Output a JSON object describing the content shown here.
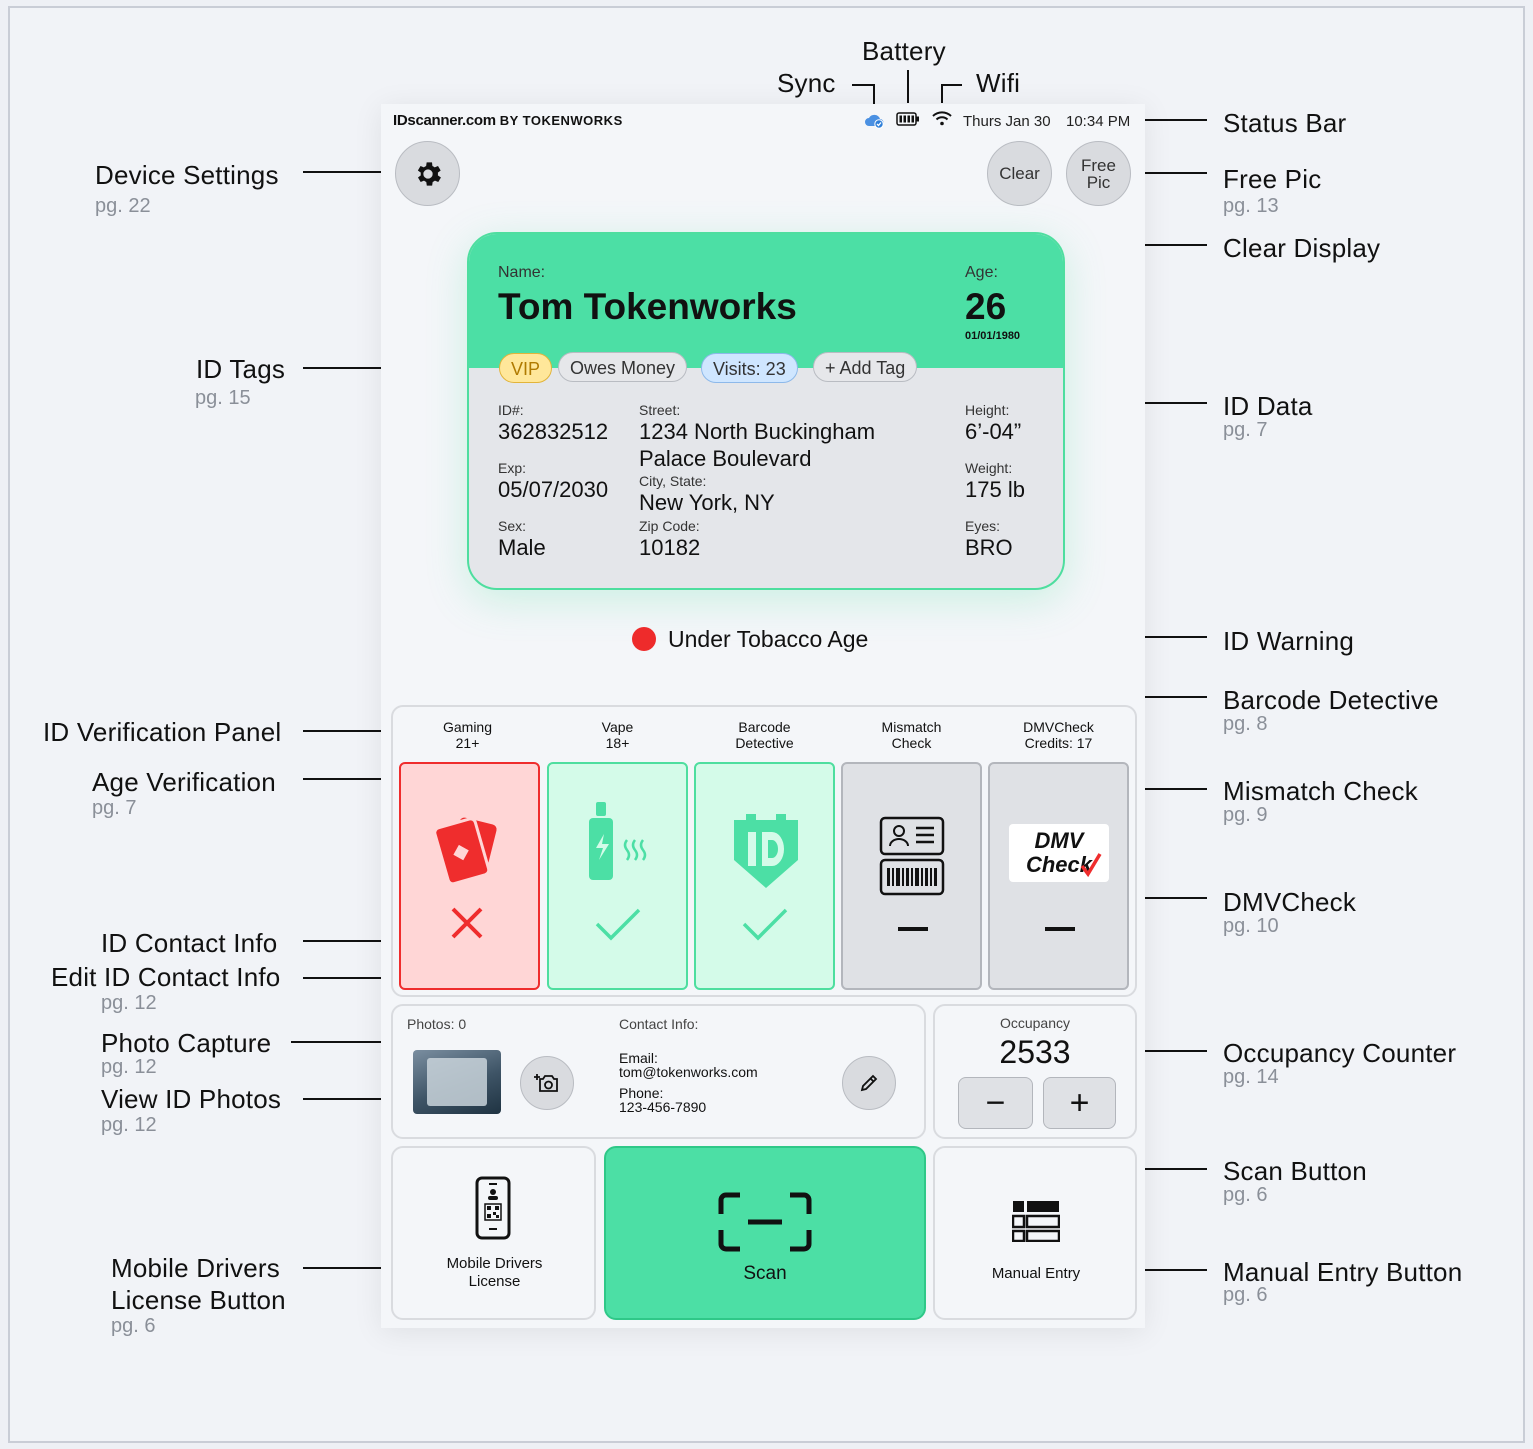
{
  "annotations": {
    "battery": "Battery",
    "sync": "Sync",
    "wifi": "Wifi",
    "status_bar": "Status Bar",
    "device_settings": "Device Settings",
    "device_settings_pg": "pg. 22",
    "free_pic": "Free Pic",
    "free_pic_pg": "pg. 13",
    "clear_display": "Clear Display",
    "id_tags": "ID Tags",
    "id_tags_pg": "pg. 15",
    "id_data": "ID Data",
    "id_data_pg": "pg. 7",
    "id_warning": "ID Warning",
    "barcode_detective": "Barcode Detective",
    "barcode_detective_pg": "pg. 8",
    "id_verification_panel": "ID Verification Panel",
    "age_verification": "Age Verification",
    "age_verification_pg": "pg. 7",
    "mismatch_check": "Mismatch Check",
    "mismatch_check_pg": "pg. 9",
    "dmvcheck": "DMVCheck",
    "dmvcheck_pg": "pg. 10",
    "id_contact_info": "ID Contact Info",
    "edit_id_contact_info": "Edit ID Contact Info",
    "edit_id_contact_info_pg": "pg. 12",
    "photo_capture": "Photo Capture",
    "photo_capture_pg": "pg. 12",
    "view_id_photos": "View ID Photos",
    "view_id_photos_pg": "pg. 12",
    "occupancy_counter": "Occupancy Counter",
    "occupancy_counter_pg": "pg. 14",
    "scan_button": "Scan Button",
    "scan_button_pg": "pg. 6",
    "mobile_dl_button_1": "Mobile Drivers",
    "mobile_dl_button_2": "License Button",
    "mobile_dl_button_pg": "pg. 6",
    "manual_entry_button": "Manual Entry Button",
    "manual_entry_button_pg": "pg. 6"
  },
  "device": {
    "brand": "IDscanner.com",
    "brand_by": "BY TOKENWORKS",
    "date": "Thurs Jan 30",
    "time": "10:34 PM",
    "clear_label": "Clear",
    "free_pic_line1": "Free",
    "free_pic_line2": "Pic"
  },
  "id_card": {
    "name_label": "Name:",
    "name": "Tom Tokenworks",
    "age_label": "Age:",
    "age": "26",
    "dob": "01/01/1980",
    "tags": [
      "VIP",
      "Owes Money",
      "Visits: 23",
      "+ Add Tag"
    ],
    "id_label": "ID#:",
    "id_value": "362832512",
    "exp_label": "Exp:",
    "exp_value": "05/07/2030",
    "sex_label": "Sex:",
    "sex_value": "Male",
    "street_label": "Street:",
    "street_line1": "1234 North Buckingham",
    "street_line2": "Palace Boulevard",
    "city_label": "City, State:",
    "city_value": "New York, NY",
    "zip_label": "Zip Code:",
    "zip_value": "10182",
    "height_label": "Height:",
    "height_value": "6’-04”",
    "weight_label": "Weight:",
    "weight_value": "175 lb",
    "eyes_label": "Eyes:",
    "eyes_value": "BRO"
  },
  "warning": {
    "text": "Under Tobacco Age",
    "color": "#ee2b2b"
  },
  "verification": {
    "columns": [
      {
        "line1": "Gaming",
        "line2": "21+",
        "status": "fail"
      },
      {
        "line1": "Vape",
        "line2": "18+",
        "status": "pass"
      },
      {
        "line1": "Barcode",
        "line2": "Detective",
        "status": "pass"
      },
      {
        "line1": "Mismatch",
        "line2": "Check",
        "status": "none"
      },
      {
        "line1": "DMVCheck",
        "line2": "Credits: 17",
        "status": "none"
      }
    ],
    "dmv_logo_line1": "DMV",
    "dmv_logo_line2": "Check"
  },
  "photos": {
    "label": "Photos: 0"
  },
  "contact": {
    "label": "Contact Info:",
    "email_label": "Email:",
    "email": "tom@tokenworks.com",
    "phone_label": "Phone:",
    "phone": "123-456-7890"
  },
  "occupancy": {
    "label": "Occupancy",
    "value": "2533",
    "minus": "−",
    "plus": "+"
  },
  "buttons": {
    "mobile_dl_line1": "Mobile Drivers",
    "mobile_dl_line2": "License",
    "scan": "Scan",
    "manual_entry": "Manual Entry"
  },
  "colors": {
    "accent_green": "#4cdfa5",
    "fail_red": "#ef2d2d",
    "tag_vip": "#ffe79a",
    "tag_visits": "#cfe6ff"
  }
}
